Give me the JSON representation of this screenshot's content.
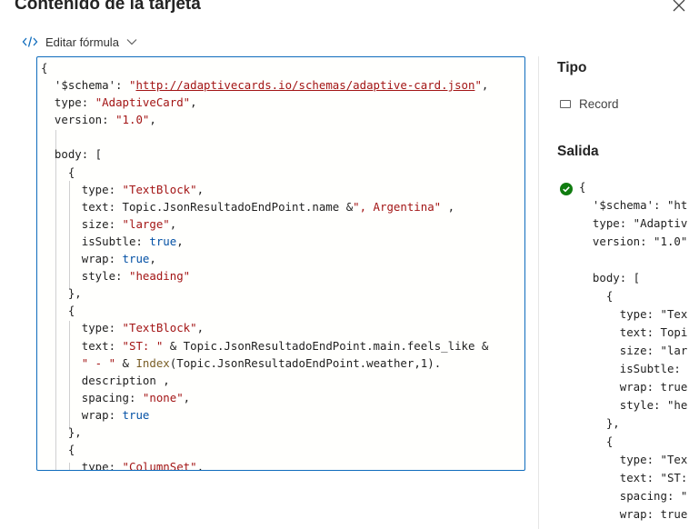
{
  "dialog": {
    "title": "Contenido de la tarjeta",
    "close_icon": "close-icon"
  },
  "toolbar": {
    "edit_formula_label": "Editar fórmula",
    "code_icon": "code-icon",
    "chevron_icon": "chevron-down-icon"
  },
  "editor": {
    "lines": [
      "{",
      "  '$schema': \"http://adaptivecards.io/schemas/adaptive-card.json\",",
      "  type: \"AdaptiveCard\",",
      "  version: \"1.0\",",
      "",
      "  body: [",
      "    {",
      "      type: \"TextBlock\",",
      "      text: Topic.JsonResultadoEndPoint.name &\", Argentina\" ,",
      "      size: \"large\",",
      "      isSubtle: true,",
      "      wrap: true,",
      "      style: \"heading\"",
      "    },",
      "    {",
      "      type: \"TextBlock\",",
      "      text: \"ST: \" & Topic.JsonResultadoEndPoint.main.feels_like &",
      "      \" - \" & Index(Topic.JsonResultadoEndPoint.weather,1).",
      "      description ,",
      "      spacing: \"none\",",
      "      wrap: true",
      "    },",
      "    {",
      "      type: \"ColumnSet\","
    ]
  },
  "sidebar": {
    "type_heading": "Tipo",
    "type_value": "Record",
    "output_heading": "Salida",
    "status_icon": "check-circle-icon",
    "status_color": "#107c10",
    "output_lines": [
      "{",
      "  '$schema': \"ht",
      "  type: \"Adaptiv",
      "  version: \"1.0\"",
      "",
      "  body: [",
      "    {",
      "      type: \"Tex",
      "      text: Topi",
      "      size: \"lar",
      "      isSubtle:",
      "      wrap: true",
      "      style: \"he",
      "    },",
      "    {",
      "      type: \"Tex",
      "      text: \"ST:",
      "      spacing: \"",
      "      wrap: true"
    ]
  },
  "colors": {
    "accent": "#0f6cbd",
    "string": "#a31515",
    "keyword": "#0000ff",
    "boolean": "#0451a5"
  }
}
